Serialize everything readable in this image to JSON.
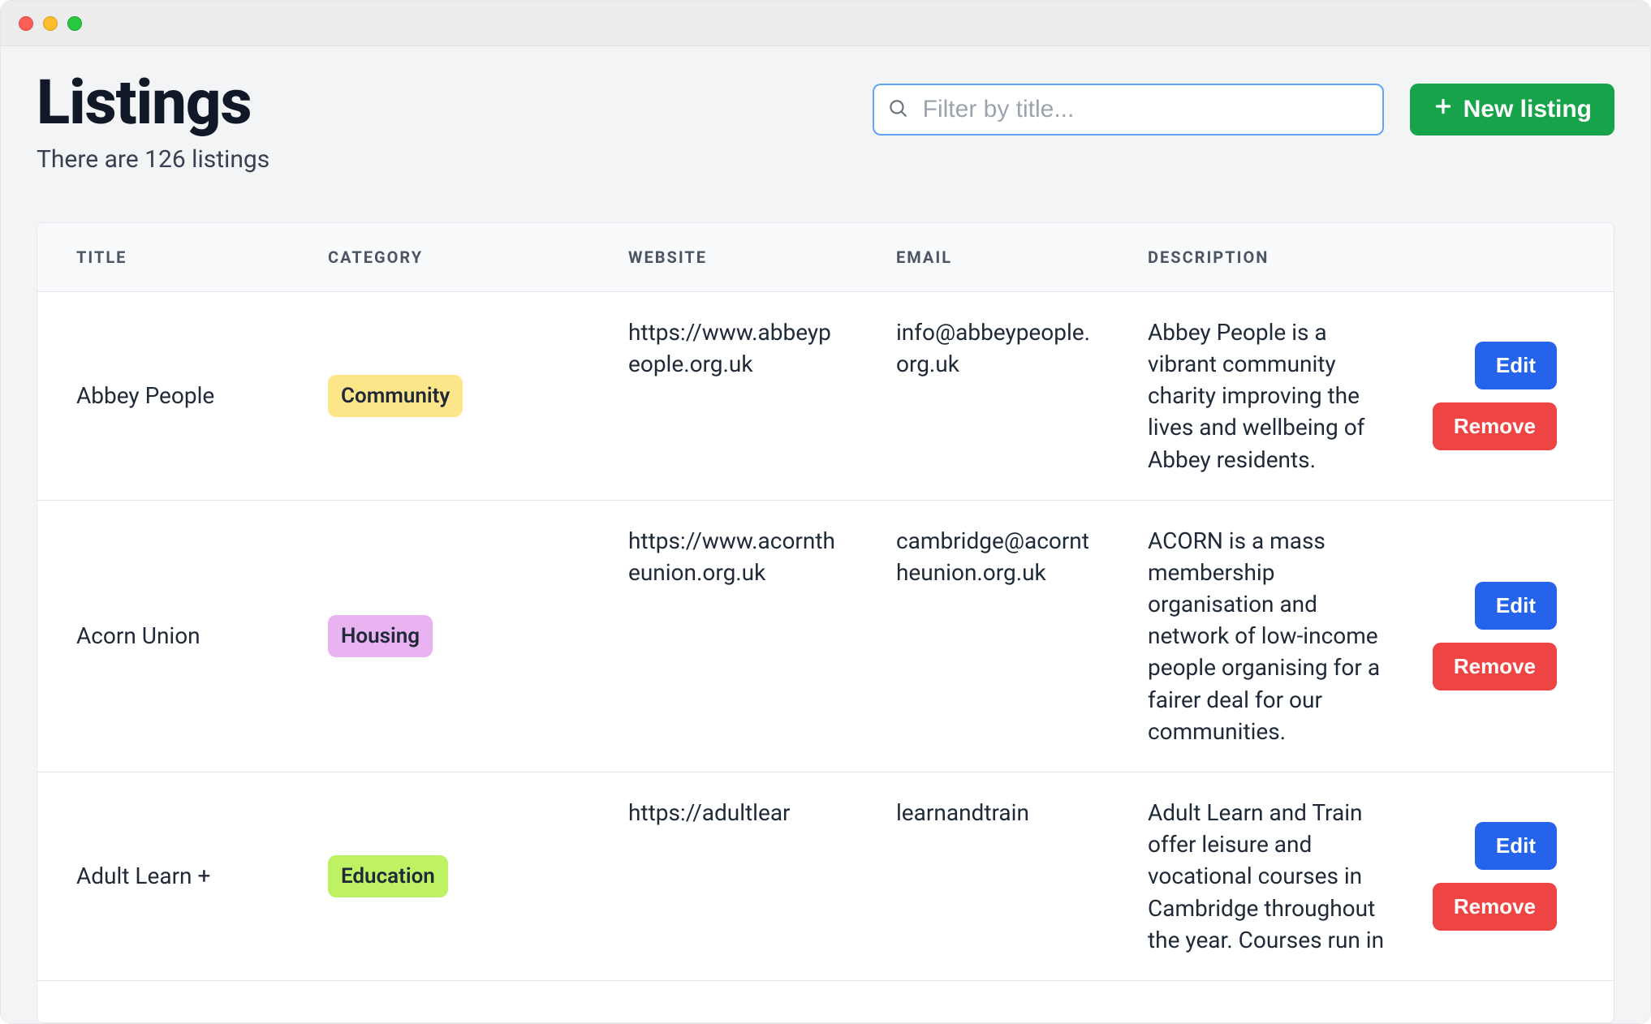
{
  "page": {
    "title": "Listings",
    "subtitle": "There are 126 listings"
  },
  "search": {
    "placeholder": "Filter by title..."
  },
  "new_button": {
    "label": "New listing"
  },
  "table": {
    "columns": [
      "TITLE",
      "CATEGORY",
      "WEBSITE",
      "EMAIL",
      "DESCRIPTION"
    ],
    "rows": [
      {
        "title": "Abbey People",
        "category": {
          "label": "Community",
          "bg": "#fde68a"
        },
        "website": "https://www.abbeypeople.org.uk",
        "email": "info@abbeypeople.org.uk",
        "description": "Abbey People is a vibrant community charity improving the lives and wellbeing of Abbey residents."
      },
      {
        "title": "Acorn Union",
        "category": {
          "label": "Housing",
          "bg": "#e9b3f2"
        },
        "website": "https://www.acorntheunion.org.uk",
        "email": "cambridge@acorntheunion.org.uk",
        "description": "ACORN is a mass membership organisation and network of low-income people organising for a fairer deal for our communities."
      },
      {
        "title": "Adult Learn + ",
        "category": {
          "label": "Education",
          "bg": "#bef264"
        },
        "website": "https://adultlear",
        "email": "learnandtrain",
        "description": "Adult Learn and Train offer leisure and vocational courses in Cambridge throughout the year. Courses run in"
      }
    ]
  },
  "actions": {
    "edit": "Edit",
    "remove": "Remove"
  }
}
